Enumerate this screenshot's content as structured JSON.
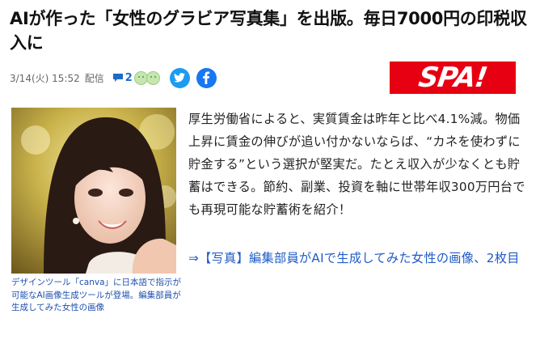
{
  "article": {
    "headline": "AIが作った「女性のグラビア写真集」を出版。毎日7000円の印税収入に",
    "date": "3/14(火) 15:52",
    "source_label": "配信",
    "comment_count": "2",
    "body": "厚生労働省によると、実質賃金は昨年と比べ4.1%減。物価上昇に賃金の伸びが追い付かないならば、“カネを使わずに貯金する”という選択が堅実だ。たとえ収入が少なくとも貯蓄はできる。節約、副業、投資を軸に世帯年収300万円台でも再現可能な貯蓄術を紹介！",
    "related_link": "⇒【写真】編集部員がAIで生成してみた女性の画像、2枚目",
    "photo_caption": "デザインツール「canva」に日本語で指示が可能なAI画像生成ツールが登場。編集部員が生成してみた女性の画像"
  },
  "publisher": {
    "logo_text": "SPA!",
    "logo_color": "#e60012"
  },
  "icons": {
    "comment": "comment-bubble-icon",
    "reactions": "smiley-faces-icon",
    "twitter": "twitter-bird-icon",
    "facebook": "facebook-f-icon"
  },
  "colors": {
    "link": "#1f5bc6",
    "twitter": "#1d9bf0",
    "facebook": "#1877f2"
  }
}
